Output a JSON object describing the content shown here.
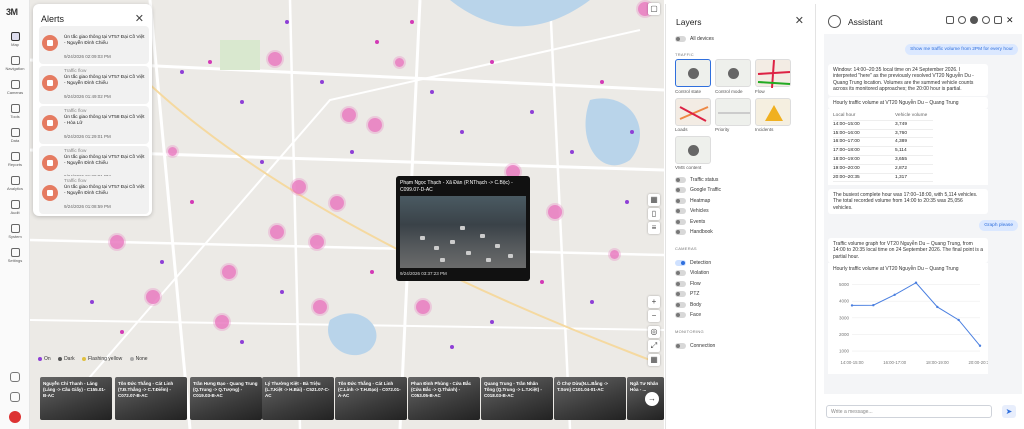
{
  "nav": {
    "logo": "3M",
    "items": [
      {
        "label": "Map",
        "active": true
      },
      {
        "label": "Navigation"
      },
      {
        "label": "Cameras"
      },
      {
        "label": "Tools"
      },
      {
        "label": "Data"
      },
      {
        "label": "Reports"
      },
      {
        "label": "Analytics"
      },
      {
        "label": "Audit"
      },
      {
        "label": "System"
      },
      {
        "label": "Settings"
      }
    ]
  },
  "alerts": {
    "title": "Alerts",
    "items": [
      {
        "type": "Traffic flow",
        "message": "Ùn tắc giao thông tại VT57 Đại Cồ Việt - Nguyễn Đình Chiểu",
        "time": "9/24/2026 02:09:03 PM"
      },
      {
        "type": "Traffic flow",
        "message": "Ùn tắc giao thông tại VT57 Đại Cồ Việt - Nguyễn Đình Chiểu",
        "time": "9/24/2026 01:49:02 PM"
      },
      {
        "type": "Traffic flow",
        "message": "Ùn tắc giao thông tại VT58 Đại Cồ Việt - Hòa Lữ",
        "time": "9/24/2026 01:29:01 PM"
      },
      {
        "type": "Traffic flow",
        "message": "Ùn tắc giao thông tại VT57 Đại Cồ Việt - Nguyễn Đình Chiểu",
        "time": "9/24/2026 01:29:01 PM"
      },
      {
        "type": "Traffic flow",
        "message": "Ùn tắc giao thông tại VT57 Đại Cồ Việt - Nguyễn Đình Chiểu",
        "time": "9/24/2026 01:08:59 PM"
      }
    ]
  },
  "popup": {
    "title": "Phạm Ngọc Thạch - Xã Đàn (P.NThạch -> C.Bộc) - C099.07-D-AC",
    "time": "9/24/2026 03:37:23 PM"
  },
  "legend": [
    {
      "label": "On",
      "color": "#8e3fd6"
    },
    {
      "label": "Dark",
      "color": "#555555"
    },
    {
      "label": "Flashing yellow",
      "color": "#e0c040"
    },
    {
      "label": "None",
      "color": "#aaaaaa"
    }
  ],
  "cameras": [
    "Nguyễn Chí Thanh - Láng (Láng -> Cầu Giấy) - C155.01-B-AC",
    "Tôn Đức Thắng - Cát Linh (T.Đ.Thắng -> C.T.Điểm) - C072.07-B-AC",
    "Trần Hưng Đạo - Quang Trung (Q.Trung -> Q.Tượng) - C019.03-B-AC",
    "Lý Thường Kiệt - Bà Triệu (L.T.Kiệt -> H.Bài) - C521.07-C-AC",
    "Tôn Đức Thắng - Cát Linh (C.Linh -> T.H.Đạo) - C072.01-A-AC",
    "Phan Đình Phùng - Cửa Bắc (Cửa Bắc -> Q.Thánh) - C053.05-B-AC",
    "Quang Trung - Trần Nhân Tông (Q.Trung -> L.T.Kiệt) - C018.03-B-AC",
    "Ô Chợ Dừa(N.L.Bằng -> T.Sơn) C101.04-01-AC",
    "Ngã Tư Nhân Hòa - ..."
  ],
  "layers": {
    "title": "Layers",
    "all_devices": "All devices",
    "traffic_section": "TRAFFIC",
    "tiles": [
      "Control state",
      "Control mode",
      "Flow",
      "Loads",
      "Priority",
      "Incidents",
      "VMS content"
    ],
    "traffic_toggles": [
      "Traffic status",
      "Google Traffic",
      "Heatmap",
      "Vehicles",
      "Events",
      "Handbook"
    ],
    "cameras_section": "CAMERAS",
    "camera_toggles": [
      "Detection",
      "Violation",
      "Flow",
      "PTZ",
      "Body",
      "Face"
    ],
    "monitoring_section": "MONITORING",
    "monitoring_toggles": [
      "Connection"
    ]
  },
  "assistant": {
    "title": "Assistant",
    "user_msg_1": "Show me traffic volume from 2PM for every hour",
    "reply_1": "Window: 14:00–20:35 local time on 24 September 2026. I interpreted \"here\" as the previously resolved VT20 Nguyễn Du - Quang Trung location. Volumes are the summed vehicle counts across its monitored approaches; the 20:00 hour is partial.",
    "table_title": "Hourly traffic volume at VT20 Nguyễn Du – Quang Trung",
    "table_headers": [
      "Local hour",
      "Vehicle volume"
    ],
    "table_rows": [
      [
        "14:00–15:00",
        "3,749"
      ],
      [
        "15:00–16:00",
        "3,760"
      ],
      [
        "16:00–17:00",
        "4,389"
      ],
      [
        "17:00–18:00",
        "5,114"
      ],
      [
        "18:00–19:00",
        "3,655"
      ],
      [
        "19:00–20:00",
        "2,872"
      ],
      [
        "20:00–20:35",
        "1,317"
      ]
    ],
    "reply_2": "The busiest complete hour was 17:00–18:00, with 5,114 vehicles. The total recorded volume from 14:00 to 20:35 was 25,056 vehicles.",
    "user_msg_2": "Graph please",
    "reply_3": "Traffic volume graph for VT20 Nguyễn Du – Quang Trung, from 14:00 to 20:35 local time on 24 September 2026. The final point is a partial hour.",
    "input_placeholder": "Write a message..."
  },
  "chart_data": {
    "type": "line",
    "title": "Hourly traffic volume at VT20 Nguyễn Du – Quang Trung",
    "x": [
      "14:00-15:00",
      "15:00-16:00",
      "16:00-17:00",
      "17:00-18:00",
      "18:00-19:00",
      "19:00-20:00",
      "20:00-20:35"
    ],
    "tick_labels": [
      "14:00-15:00",
      "16:00-17:00",
      "18:00-19:00",
      "20:00-20:35"
    ],
    "values": [
      3749,
      3760,
      4389,
      5114,
      3655,
      2872,
      1317
    ],
    "yticks": [
      1000,
      2000,
      3000,
      4000,
      5000
    ],
    "ylim": [
      700,
      5400
    ],
    "color": "#4a7fe0"
  }
}
